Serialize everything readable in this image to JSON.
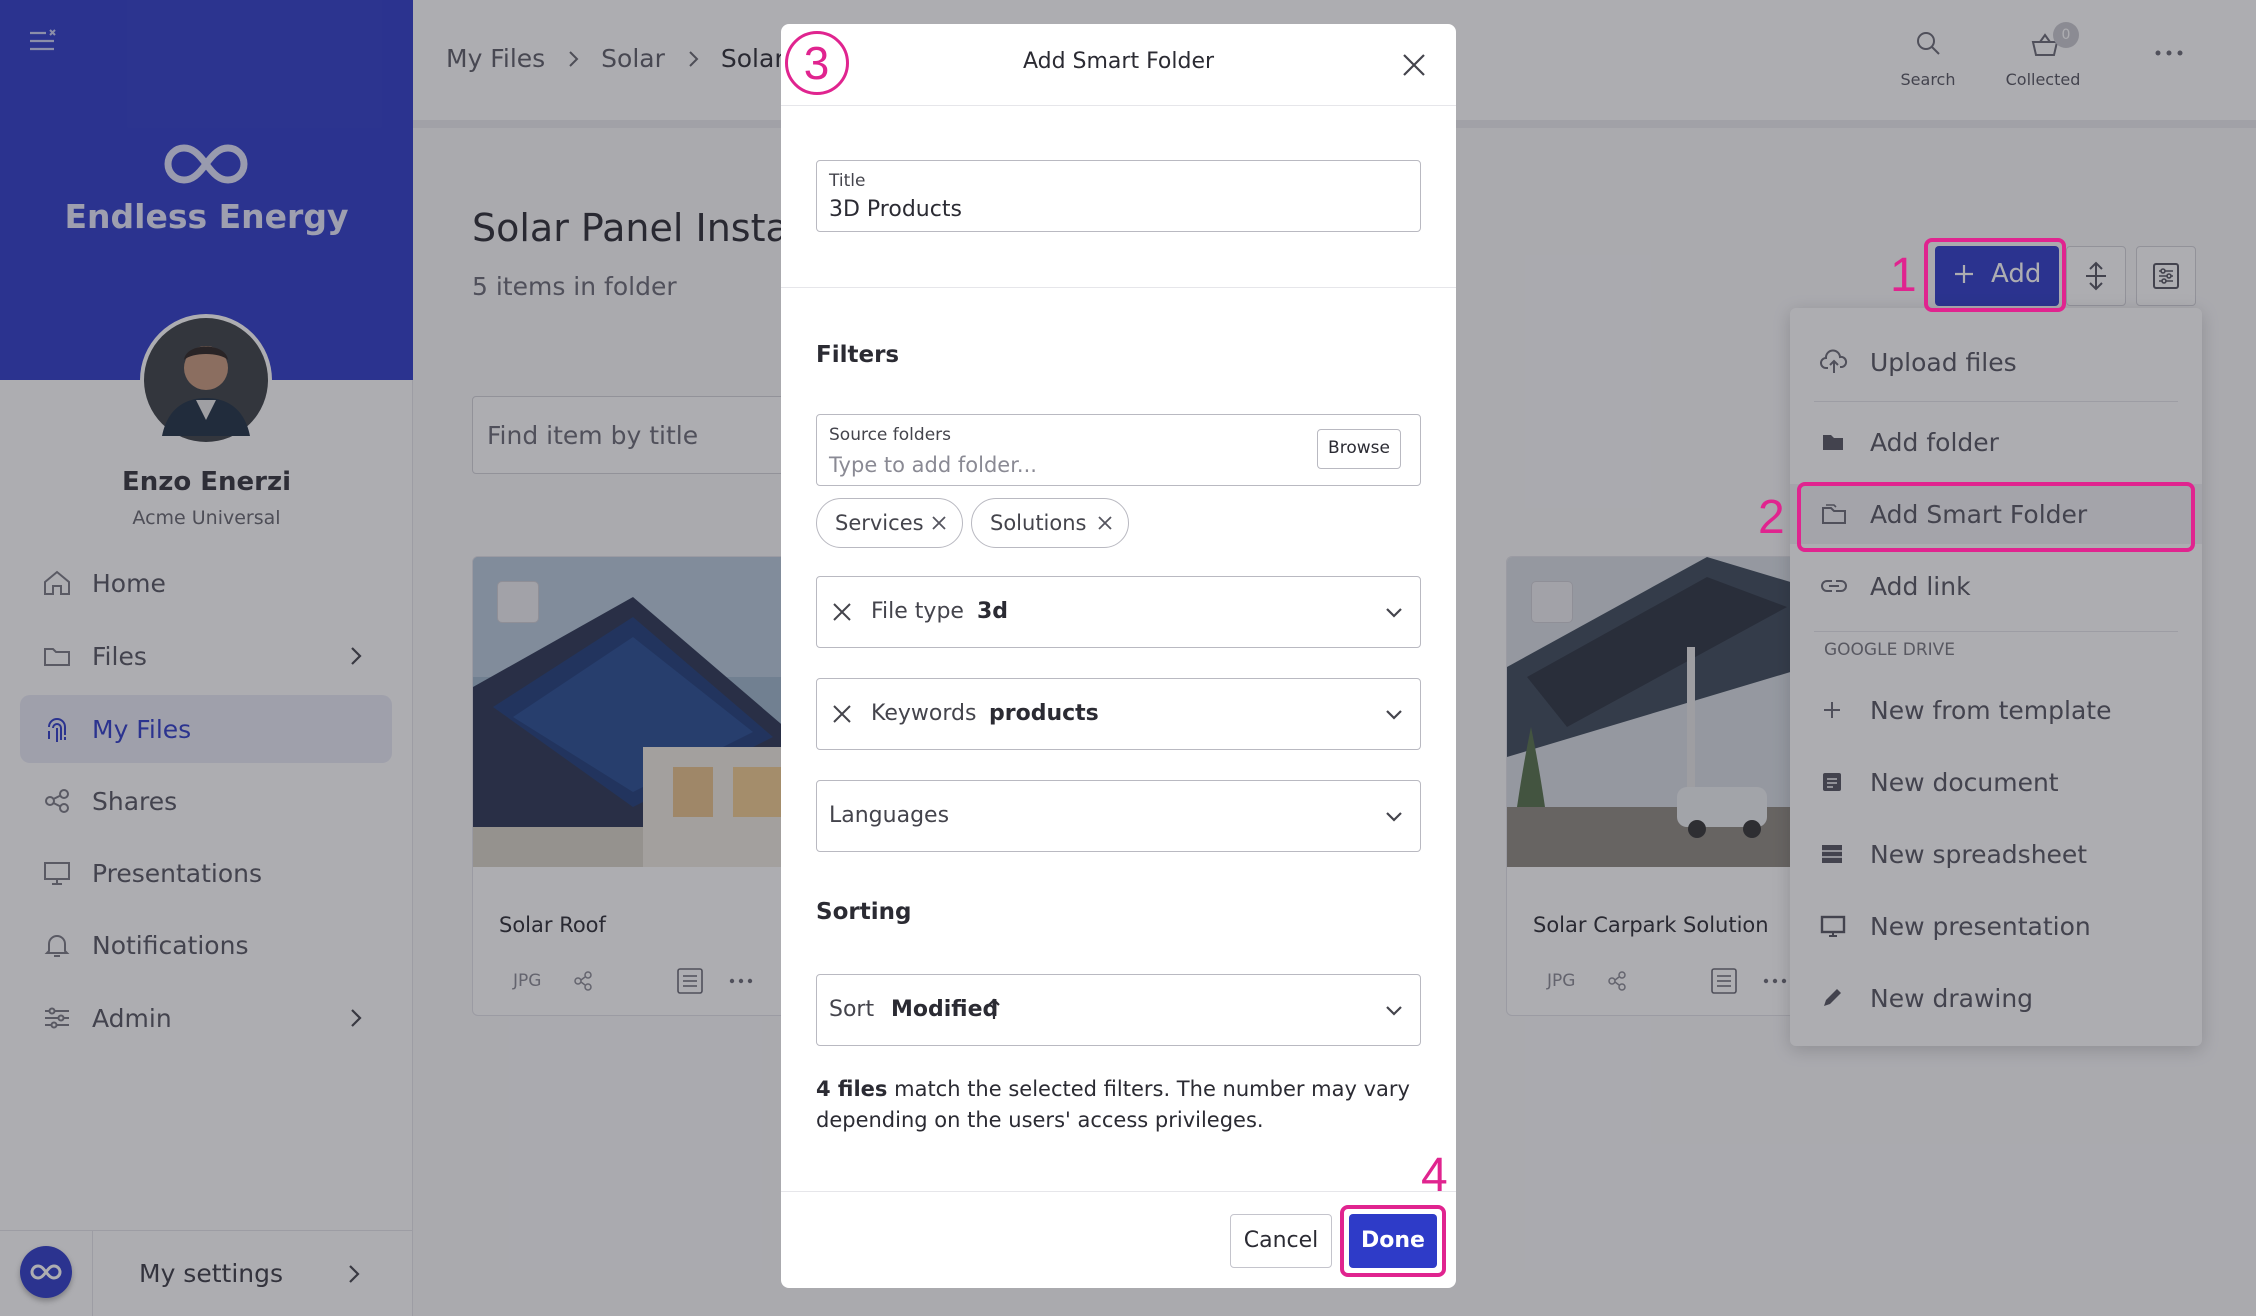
{
  "sidebar": {
    "brand_name": "Endless Energy",
    "user_name": "Enzo Enerzi",
    "user_org": "Acme Universal",
    "nav": [
      {
        "label": "Home",
        "icon": "home-icon"
      },
      {
        "label": "Files",
        "icon": "folder-icon"
      },
      {
        "label": "My Files",
        "icon": "fingerprint-icon"
      },
      {
        "label": "Shares",
        "icon": "share-icon"
      },
      {
        "label": "Presentations",
        "icon": "monitor-icon"
      },
      {
        "label": "Notifications",
        "icon": "bell-icon"
      },
      {
        "label": "Admin",
        "icon": "sliders-icon"
      }
    ],
    "settings_label": "My settings"
  },
  "topbar": {
    "breadcrumb": [
      "My Files",
      "Solar",
      "Solar P"
    ],
    "search_label": "Search",
    "collected_label": "Collected",
    "collected_count": "0"
  },
  "page": {
    "title": "Solar Panel Instal",
    "subtitle": "5 items in folder",
    "search_placeholder": "Find item by title",
    "add_label": "Add"
  },
  "cards": [
    {
      "title": "Solar Roof",
      "type": "JPG"
    },
    {
      "title": "Solar Carpark Solution",
      "type": "JPG"
    }
  ],
  "add_menu": {
    "items": [
      {
        "label": "Upload files",
        "icon": "cloud-upload-icon"
      },
      {
        "label": "Add folder",
        "icon": "folder-icon"
      },
      {
        "label": "Add Smart Folder",
        "icon": "smart-folder-icon"
      },
      {
        "label": "Add link",
        "icon": "link-icon"
      }
    ],
    "section_label": "GOOGLE DRIVE",
    "drive_items": [
      {
        "label": "New from template",
        "icon": "plus-icon"
      },
      {
        "label": "New document",
        "icon": "document-icon"
      },
      {
        "label": "New spreadsheet",
        "icon": "spreadsheet-icon"
      },
      {
        "label": "New presentation",
        "icon": "presentation-icon"
      },
      {
        "label": "New drawing",
        "icon": "pen-icon"
      }
    ]
  },
  "modal": {
    "title": "Add Smart Folder",
    "title_field_label": "Title",
    "title_field_value": "3D Products",
    "filters_heading": "Filters",
    "source_label": "Source folders",
    "source_placeholder": "Type to add folder...",
    "browse_label": "Browse",
    "chips": [
      "Services",
      "Solutions"
    ],
    "filetype_label": "File type",
    "filetype_value": "3d",
    "keywords_label": "Keywords",
    "keywords_value": "products",
    "languages_label": "Languages",
    "sorting_heading": "Sorting",
    "sort_label": "Sort",
    "sort_value": "Modified",
    "match_bold": "4 files",
    "match_rest": " match the selected filters. The number may vary depending on the users' access privileges.",
    "cancel_label": "Cancel",
    "done_label": "Done"
  },
  "annotations": {
    "step1": "1",
    "step2": "2",
    "step3": "3",
    "step4": "4"
  },
  "colors": {
    "brand": "#2e3bc8",
    "highlight": "#e0248f"
  }
}
